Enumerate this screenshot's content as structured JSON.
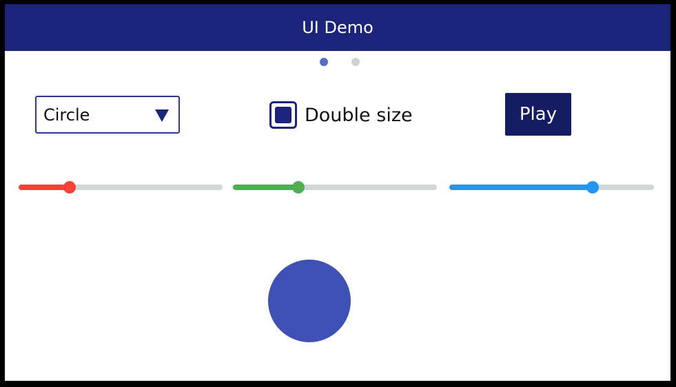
{
  "app": {
    "title": "UI Demo"
  },
  "pager": {
    "pages": [
      {
        "active": true
      },
      {
        "active": false
      }
    ],
    "active_color": "#5b6bbf",
    "inactive_color": "#cfd2d2"
  },
  "controls": {
    "shape_select": {
      "value": "Circle",
      "icon": "triangle-down-icon"
    },
    "double_size": {
      "label": "Double size",
      "checked": true
    },
    "play_button": {
      "label": "Play"
    }
  },
  "sliders": [
    {
      "name": "red-slider",
      "value": 0.25,
      "color": "#f44336"
    },
    {
      "name": "green-slider",
      "value": 0.32,
      "color": "#4caf50"
    },
    {
      "name": "blue-slider",
      "value": 0.7,
      "color": "#2196f3"
    }
  ],
  "preview": {
    "shape": "circle",
    "color": "#3f51b5"
  },
  "colors": {
    "title_bar": "#1b237a",
    "accent": "#1b237a",
    "track": "#d3d6d6"
  }
}
